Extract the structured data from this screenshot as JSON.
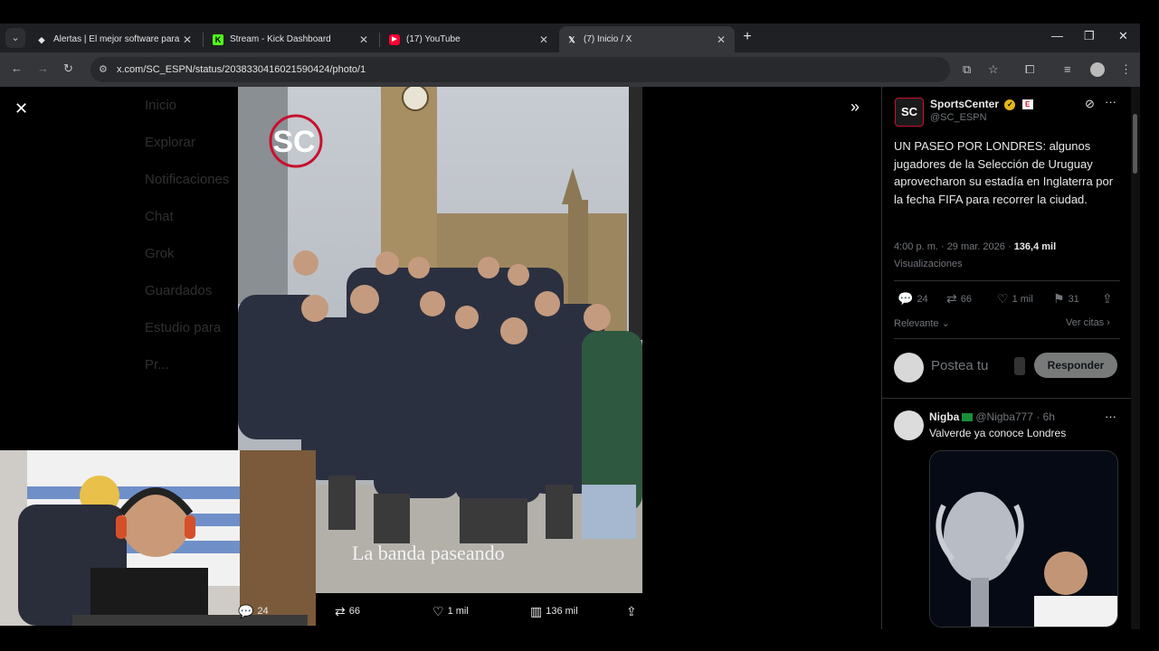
{
  "browser": {
    "tabs": [
      {
        "title": "Alertas | El mejor software para",
        "active": false,
        "favicon_color": "#e3e3e3"
      },
      {
        "title": "Stream - Kick Dashboard",
        "active": false,
        "favicon_color": "#53fc18"
      },
      {
        "title": "(17) YouTube",
        "active": false,
        "favicon_color": "#ff0033"
      },
      {
        "title": "(7) Inicio / X",
        "active": true,
        "favicon_color": "#ffffff"
      }
    ],
    "url": "x.com/SC_ESPN/status/2038330416021590424/photo/1"
  },
  "background_nav": [
    "Inicio",
    "Explorar",
    "Notificaciones",
    "Chat",
    "Grok",
    "Guardados",
    "Estudio para",
    "Pr..."
  ],
  "photo": {
    "caption": "La banda paseando",
    "logo_text": "SC"
  },
  "photo_actions": {
    "replies": "24",
    "reposts": "66",
    "likes": "1 mil",
    "views": "136 mil"
  },
  "tweet": {
    "author_name": "SportsCenter",
    "author_handle": "@SC_ESPN",
    "avatar_text": "SC",
    "text": "UN PASEO POR LONDRES: algunos jugadores de la Selección de Uruguay aprovecharon su estadía en Inglaterra por la fecha FIFA para recorrer la ciudad.",
    "time": "4:00 p. m. · 29 mar. 2026 · ",
    "views_count": "136,4 mil",
    "views_label": "Visualizaciones",
    "stats": {
      "replies": "24",
      "reposts": "66",
      "likes": "1 mil",
      "bookmarks": "31"
    },
    "sort_label": "Relevante",
    "quotes_label": "Ver citas"
  },
  "composer": {
    "placeholder": "Postea tu",
    "reply_button": "Responder"
  },
  "reply": {
    "name": "Nigba",
    "handle_time": "@Nigba777 · 6h",
    "text": "Valverde ya conoce Londres"
  },
  "colors": {
    "accent": "#1d9bf0",
    "espn_red": "#c8102e",
    "chrome_bg": "#35363a"
  }
}
